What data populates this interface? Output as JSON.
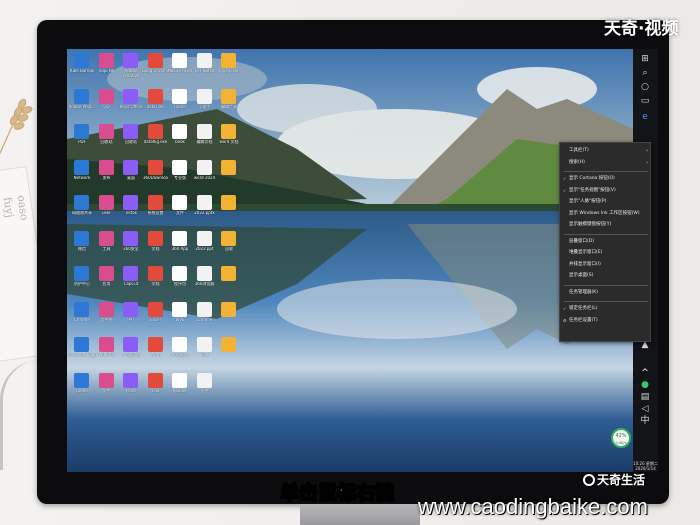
{
  "overlay": {
    "top_watermark": "天奇·视频",
    "subtitle": "单击鼠标右键",
    "brand_logo": "天奇生活",
    "site_url": "www.caodingbaike.com"
  },
  "room": {
    "paper_text": "oaso fuyj"
  },
  "desktop": {
    "icon_labels": [
      "Kibe Barrow",
      "lnqu NIl",
      "Adobe Creative",
      "Goog Chrome",
      "Music Player",
      "ver Notes",
      "Inve Jcker",
      "Adobe Phot...",
      "QQ",
      "Keys Office",
      "dataFiles",
      "Folder",
      "小助手",
      "编辑工具",
      "PDF",
      "回收站",
      "回收站",
      "dataflig.exe",
      "book",
      "编辑文档",
      "word 文档",
      "Network",
      "发布",
      "桌面",
      "360Downloa",
      "专业版",
      "word 2024",
      "",
      "网络和共享",
      "user",
      "Tiktok",
      "系统设置",
      "文件",
      "2022.pptx",
      "",
      "微信",
      "工具",
      "360安全",
      "文档",
      "360 App",
      "2022.ppt",
      "回收",
      "防护中心",
      "应用",
      "CapCut",
      "文档",
      "程序包",
      "360浏览器",
      "",
      "Chrome",
      "文件夹",
      "PPT",
      "Excel",
      "WPS",
      "Chrome",
      "",
      "Microsoft Edge",
      "WinRAR",
      "Xiaoying",
      "Word",
      "Notepad",
      "Text",
      "",
      "Folder",
      "文件",
      "Paint",
      "Text",
      "Reader",
      "文件"
    ]
  },
  "context_menu": {
    "items": [
      {
        "label": "工具栏(T)",
        "arrow": true
      },
      {
        "label": "搜索(H)",
        "arrow": true
      },
      {
        "label": "显示 Cortana 按钮(O)",
        "checked": true
      },
      {
        "label": "显示\"任务视图\"按钮(V)",
        "checked": true
      },
      {
        "label": "显示\"人脉\"按钮(P)"
      },
      {
        "label": "显示 Windows Ink 工作区按钮(W)"
      },
      {
        "label": "显示触摸键盘按钮(Y)"
      },
      {
        "label": "层叠窗口(D)"
      },
      {
        "label": "堆叠显示窗口(E)"
      },
      {
        "label": "并排显示窗口(I)"
      },
      {
        "label": "显示桌面(S)"
      },
      {
        "label": "任务管理器(K)"
      },
      {
        "label": "锁定任务栏(L)",
        "checked": true
      },
      {
        "label": "任务栏设置(T)",
        "gear": true
      }
    ]
  },
  "taskbar": {
    "clock": "10:26 星期二 2020/1/14",
    "network_percent": "42%",
    "network_speed": "0.0K/s"
  },
  "colors": {
    "context_bg": "#2b2b2b",
    "taskbar_bg": "#121418",
    "subtitle_fill": "#ffffff"
  }
}
